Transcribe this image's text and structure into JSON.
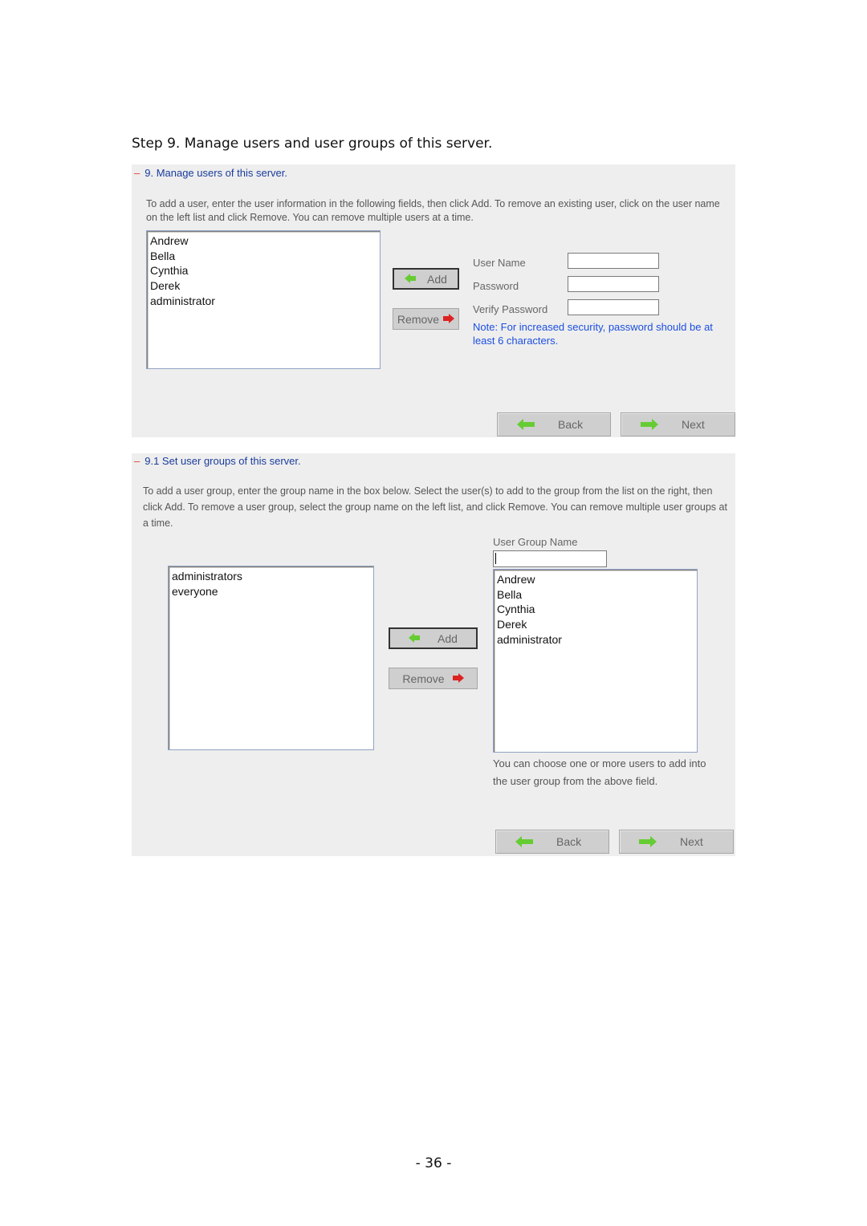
{
  "step_title": "Step 9.  Manage users and user groups of this server.",
  "section1": {
    "collapse_symbol": "–",
    "heading": "9. Manage users of this server.",
    "description": "To add a user, enter the user information in the following fields, then click Add. To remove an existing user, click on the user name on the left list and click Remove. You can remove multiple users at a time.",
    "users_list": [
      "Andrew",
      "Bella",
      "Cynthia",
      "Derek",
      "administrator"
    ],
    "add_label": "Add",
    "remove_label": "Remove",
    "fields": {
      "user_name_label": "User Name",
      "user_name_value": "",
      "password_label": "Password",
      "password_value": "",
      "verify_password_label": "Verify Password",
      "verify_password_value": ""
    },
    "note": "Note: For increased security, password should be at least 6 characters.",
    "back_label": "Back",
    "next_label": "Next"
  },
  "section2": {
    "collapse_symbol": "–",
    "heading": "9.1 Set user groups of this server.",
    "description": "To add a user group, enter the group name in the box below. Select the user(s) to add to the group from the list on the right, then click Add. To remove a user group, select the group name on the left list, and click Remove. You can remove multiple user groups at a time.",
    "groups_list": [
      "administrators",
      "everyone"
    ],
    "add_label": "Add",
    "remove_label": "Remove",
    "group_name_label": "User Group Name",
    "group_name_value": "",
    "users_list": [
      "Andrew",
      "Bella",
      "Cynthia",
      "Derek",
      "administrator"
    ],
    "hint": "You can choose one or more users to add into the user group from the above field.",
    "back_label": "Back",
    "next_label": "Next"
  },
  "icons": {
    "add_arrow_color": "#66cc33",
    "remove_arrow_color": "#dd2222",
    "nav_arrow_color": "#66cc33"
  },
  "page_number": "- 36 -"
}
